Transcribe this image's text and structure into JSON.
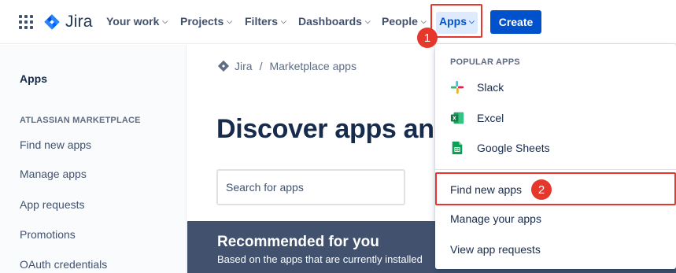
{
  "topnav": {
    "product": "Jira",
    "items": [
      {
        "label": "Your work"
      },
      {
        "label": "Projects"
      },
      {
        "label": "Filters"
      },
      {
        "label": "Dashboards"
      },
      {
        "label": "People"
      }
    ],
    "apps_label": "Apps",
    "create_label": "Create",
    "icons": {
      "launcher": "app-grid-icon",
      "chevron": "chevron-down-icon"
    }
  },
  "sidebar": {
    "title": "Apps",
    "section": "ATLASSIAN MARKETPLACE",
    "items": [
      {
        "label": "Find new apps"
      },
      {
        "label": "Manage apps"
      },
      {
        "label": "App requests"
      },
      {
        "label": "Promotions"
      },
      {
        "label": "OAuth credentials"
      }
    ]
  },
  "main": {
    "breadcrumb": {
      "root": "Jira",
      "separator": "/",
      "current": "Marketplace apps"
    },
    "hero_title": "Discover apps and i",
    "search_placeholder": "Search for apps",
    "recommended": {
      "title": "Recommended for you",
      "subtitle": "Based on the apps that are currently installed"
    }
  },
  "dropdown": {
    "heading": "POPULAR APPS",
    "apps": [
      {
        "label": "Slack",
        "icon": "slack-icon"
      },
      {
        "label": "Excel",
        "icon": "excel-icon"
      },
      {
        "label": "Google Sheets",
        "icon": "google-sheets-icon"
      }
    ],
    "links": [
      {
        "label": "Find new apps"
      },
      {
        "label": "Manage your apps"
      },
      {
        "label": "View app requests"
      }
    ]
  },
  "annotations": {
    "step1": "1",
    "step2": "2"
  },
  "colors": {
    "brand_blue": "#0052cc",
    "nav_text": "#42526e",
    "highlight_red": "#e5372b",
    "banner_bg": "#42526e"
  }
}
